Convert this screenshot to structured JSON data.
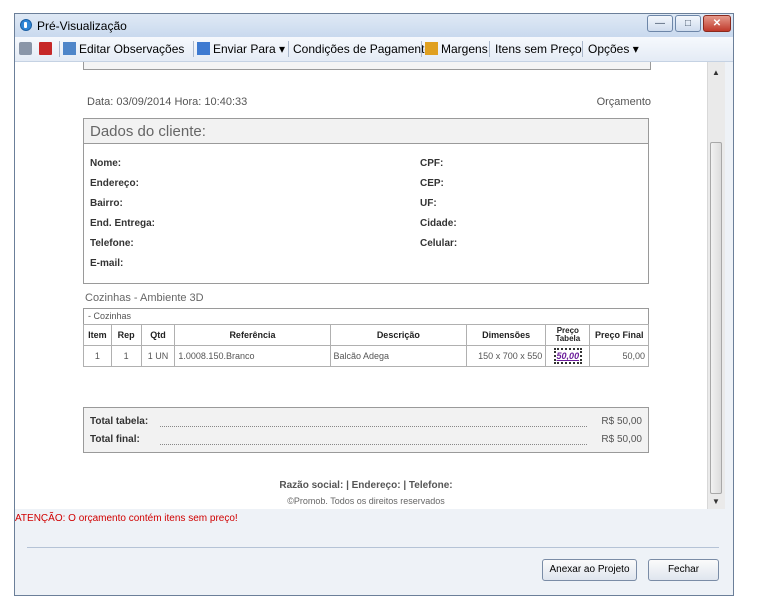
{
  "window": {
    "title": "Pré-Visualização"
  },
  "toolbar": {
    "items": [
      {
        "label": "Editar Observações"
      },
      {
        "label": "Enviar Para ▾"
      },
      {
        "label": "Condições de Pagamento"
      },
      {
        "label": "Margens"
      },
      {
        "label": "Itens sem Preço"
      },
      {
        "label": "Opções ▾"
      }
    ]
  },
  "document": {
    "date_time": "Data: 03/09/2014   Hora: 10:40:33",
    "doc_type": "Orçamento",
    "client_header": "Dados do cliente:",
    "client_fields_left": [
      "Nome:",
      "Endereço:",
      "Bairro:",
      "End. Entrega:",
      "Telefone:",
      "E-mail:"
    ],
    "client_fields_right": [
      "CPF:",
      "CEP:",
      "UF:",
      "Cidade:",
      "Celular:"
    ],
    "section_title": "Cozinhas - Ambiente 3D",
    "group_label": "- Cozinhas",
    "table": {
      "headers": [
        "Item",
        "Rep",
        "Qtd",
        "Referência",
        "Descrição",
        "Dimensões",
        "Preço Tabela",
        "Preço Final"
      ],
      "rows": [
        [
          "1",
          "1",
          "1 UN",
          "1.0008.150.Branco",
          "Balcão Adega",
          "150 x 700 x 550",
          "50,00",
          "50,00"
        ]
      ]
    },
    "totals": {
      "total_tabela_label": "Total tabela:",
      "total_tabela_value": "R$ 50,00",
      "total_final_label": "Total final:",
      "total_final_value": "R$ 50,00"
    },
    "footer_line1": "Razão social:   |   Endereço:   |   Telefone:",
    "footer_line2": "©Promob. Todos os direitos reservados"
  },
  "warning": "ATENÇÃO: O orçamento contém itens sem preço!",
  "buttons": {
    "attach": "Anexar ao Projeto",
    "close": "Fechar"
  },
  "colors": {
    "warning": "#d00000",
    "link": "#6a1b9a",
    "titlebar": "#c9d9ee"
  }
}
